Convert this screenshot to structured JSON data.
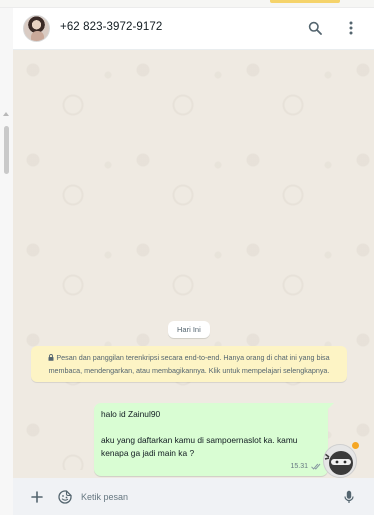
{
  "header": {
    "contact_name": "+62 823-3972-9172",
    "icons": [
      "avatar",
      "search-icon",
      "kebab-menu-icon"
    ]
  },
  "conversation": {
    "day_label": "Hari Ini",
    "encryption_notice": "Pesan dan panggilan terenkripsi secara end-to-end. Hanya orang di chat ini yang bisa membaca, mendengarkan, atau membagikannya. Klik untuk mempelajari selengkapnya.",
    "messages": [
      {
        "direction": "outgoing",
        "text": "halo id Zainul90\n\naku yang daftarkan kamu di sampoernaslot ka. kamu kenapa ga jadi main ka ?",
        "time": "15.31",
        "status": "double-check"
      }
    ]
  },
  "composer": {
    "placeholder": "Ketik pesan",
    "icons": [
      "plus-icon",
      "sticker-icon",
      "mic-icon"
    ]
  },
  "colors": {
    "chat_background": "#efeae2",
    "outgoing_bubble": "#d9fdd3",
    "notice_background": "#fdf4c5",
    "header_background": "#ffffff",
    "composer_background": "#f0f2f5"
  }
}
